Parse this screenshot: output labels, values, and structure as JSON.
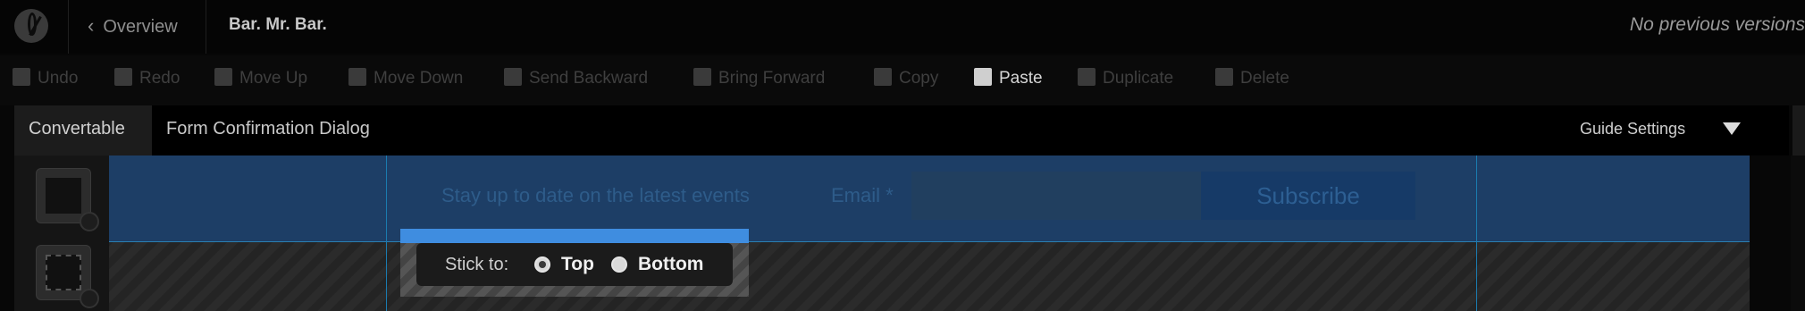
{
  "header": {
    "overview_label": "Overview",
    "page_title": "Bar. Mr. Bar.",
    "versions_text": "No previous versions"
  },
  "toolbar": {
    "items": [
      {
        "label": "Undo",
        "icon": "undo-icon",
        "enabled": false
      },
      {
        "label": "Redo",
        "icon": "redo-icon",
        "enabled": false
      },
      {
        "label": "Move Up",
        "icon": "move-up-icon",
        "enabled": false
      },
      {
        "label": "Move Down",
        "icon": "move-down-icon",
        "enabled": false
      },
      {
        "label": "Send Backward",
        "icon": "send-backward-icon",
        "enabled": false
      },
      {
        "label": "Bring Forward",
        "icon": "bring-forward-icon",
        "enabled": false
      },
      {
        "label": "Copy",
        "icon": "copy-icon",
        "enabled": false
      },
      {
        "label": "Paste",
        "icon": "paste-icon",
        "enabled": true
      },
      {
        "label": "Duplicate",
        "icon": "duplicate-icon",
        "enabled": false
      },
      {
        "label": "Delete",
        "icon": "trash-icon",
        "enabled": false
      }
    ]
  },
  "tabs": {
    "active": "Convertable",
    "secondary": "Form Confirmation Dialog",
    "guide_settings": "Guide Settings"
  },
  "bar": {
    "message": "Stay up to date on the latest events",
    "email_label": "Email *",
    "email_value": "",
    "subscribe_label": "Subscribe"
  },
  "stick_to": {
    "label": "Stick to:",
    "options": [
      "Top",
      "Bottom"
    ],
    "selected": "Top"
  },
  "colors": {
    "accent_blue": "#3f8de0",
    "bar_background": "#1d3e66"
  }
}
